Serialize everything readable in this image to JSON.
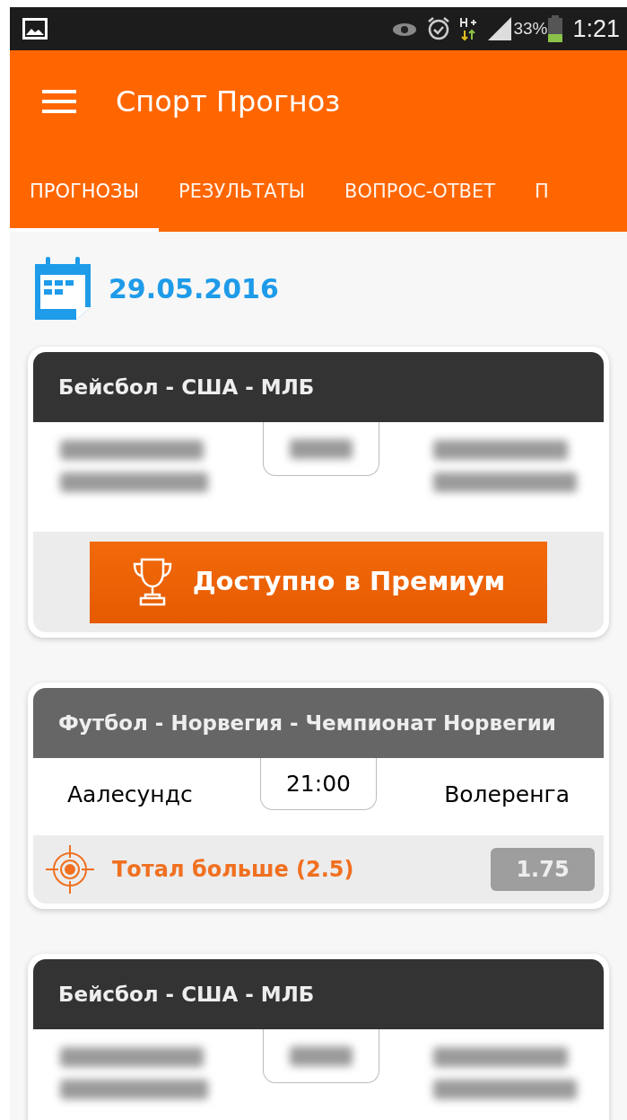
{
  "status_bar": {
    "battery": "33%",
    "time": "1:21"
  },
  "app_bar": {
    "title": "Спорт Прогноз"
  },
  "tabs": [
    {
      "label": "ПРОГНОЗЫ",
      "selected": true
    },
    {
      "label": "РЕЗУЛЬТАТЫ",
      "selected": false
    },
    {
      "label": "ВОПРОС-ОТВЕТ",
      "selected": false
    },
    {
      "label": "П",
      "selected": false
    }
  ],
  "date": "29.05.2016",
  "matches": [
    {
      "kind": "locked",
      "league": "Бейсбол - США - МЛБ",
      "button": "Доступно в Премиум"
    },
    {
      "kind": "open",
      "league": "Футбол - Норвегия - Чемпионат Норвегии",
      "home": "Аалесундс",
      "time": "21:00",
      "away": "Волеренга",
      "tip": "Тотал больше (2.5)",
      "odds": "1.75"
    },
    {
      "kind": "locked",
      "league": "Бейсбол - США - МЛБ"
    }
  ]
}
